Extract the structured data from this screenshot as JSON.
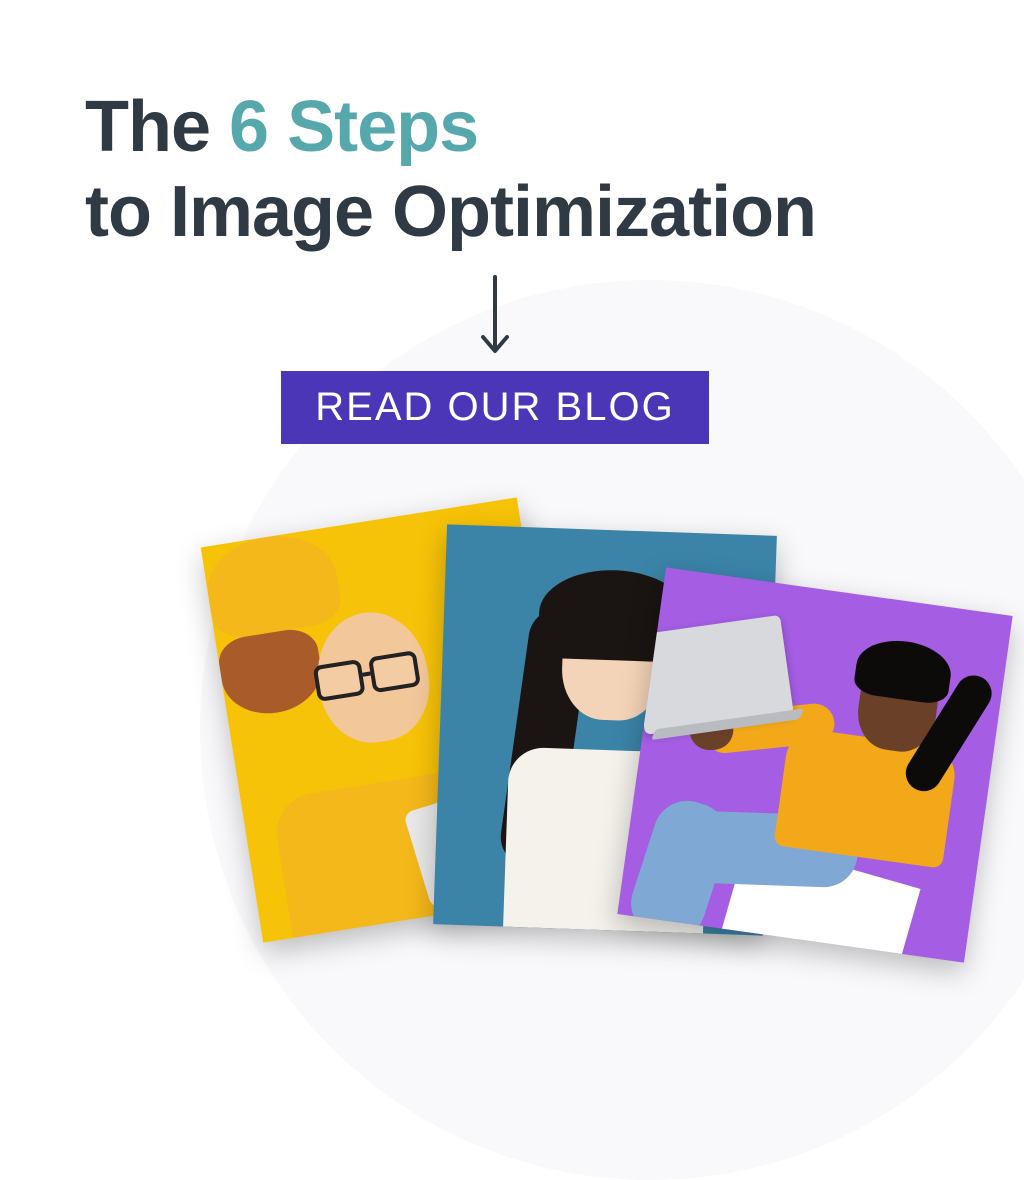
{
  "headline": {
    "part1": "The ",
    "accent": "6 Steps",
    "part2": "to Image Optimization"
  },
  "cta": {
    "label": "READ OUR BLOG"
  },
  "colors": {
    "accent_text": "#56a8ad",
    "heading_text": "#2f3a44",
    "button_bg": "#4c36b8",
    "button_text": "#ffffff",
    "card_yellow": "#f7c308",
    "card_blue": "#3b84a8",
    "card_purple": "#a45de3"
  },
  "images": {
    "cards": [
      {
        "name": "yellow-photo-card",
        "bg": "yellow",
        "subject": "bearded man in yellow beanie with glasses holding phone"
      },
      {
        "name": "blue-photo-card",
        "bg": "blue",
        "subject": "woman with long dark hair excitedly holding orange smartphone"
      },
      {
        "name": "purple-photo-card",
        "bg": "purple",
        "subject": "woman in yellow sweater and jeans holding open laptop, surprised expression"
      }
    ]
  }
}
